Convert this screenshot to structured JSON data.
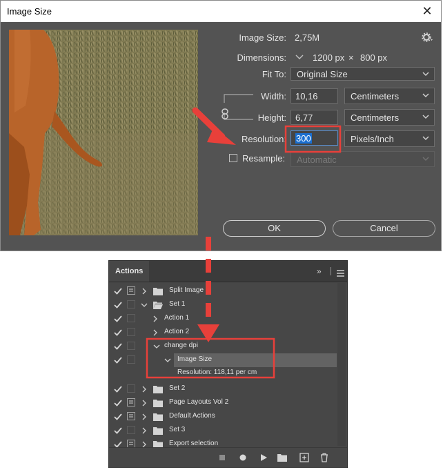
{
  "dialog": {
    "title": "Image Size",
    "close_glyph": "✕",
    "image_size_label": "Image Size:",
    "image_size_value": "2,75M",
    "dimensions_label": "Dimensions:",
    "dimensions_width": "1200 px",
    "dimensions_times": "×",
    "dimensions_height": "800 px",
    "fit_to_label": "Fit To:",
    "fit_to_value": "Original Size",
    "width_label": "Width:",
    "width_value": "10,16",
    "width_unit": "Centimeters",
    "height_label": "Height:",
    "height_value": "6,77",
    "height_unit": "Centimeters",
    "resolution_label": "Resolution:",
    "resolution_value": "300",
    "resolution_unit": "Pixels/Inch",
    "resample_label": "Resample:",
    "resample_checked": false,
    "resample_value": "Automatic",
    "ok_label": "OK",
    "cancel_label": "Cancel",
    "icons": [
      "close-icon",
      "gear-icon",
      "chevron-down-icon",
      "link-icon"
    ]
  },
  "actions_panel": {
    "tab_label": "Actions",
    "menu_glyph": "»",
    "rows": [
      {
        "label": "Split Image",
        "checked": true,
        "dialog": true,
        "kind": "set"
      },
      {
        "label": "Set 1",
        "checked": true,
        "dialog": false,
        "kind": "set-open"
      },
      {
        "label": "Action 1",
        "checked": true,
        "dialog": false,
        "kind": "action"
      },
      {
        "label": "Action 2",
        "checked": true,
        "dialog": false,
        "kind": "action"
      },
      {
        "label": "change dpi",
        "checked": true,
        "dialog": false,
        "kind": "action-open"
      },
      {
        "label": "Image Size",
        "checked": true,
        "dialog": false,
        "kind": "step-selected"
      },
      {
        "label": "Resolution: 118,11 per cm",
        "kind": "detail"
      },
      {
        "label": "Set 2",
        "checked": true,
        "dialog": false,
        "kind": "set"
      },
      {
        "label": "Page Layouts Vol 2",
        "checked": true,
        "dialog": true,
        "kind": "set"
      },
      {
        "label": "Default Actions",
        "checked": true,
        "dialog": true,
        "kind": "set"
      },
      {
        "label": "Set 3",
        "checked": true,
        "dialog": false,
        "kind": "set"
      },
      {
        "label": "Export selection",
        "checked": true,
        "dialog": true,
        "kind": "set"
      }
    ],
    "footer_icons": [
      "stop-icon",
      "record-icon",
      "play-icon",
      "new-set-icon",
      "new-action-icon",
      "delete-icon"
    ]
  },
  "colors": {
    "annotation": "#e8403a",
    "dialog_bg": "#535353",
    "panel_bg": "#474747",
    "selection": "#1a6fd1"
  }
}
